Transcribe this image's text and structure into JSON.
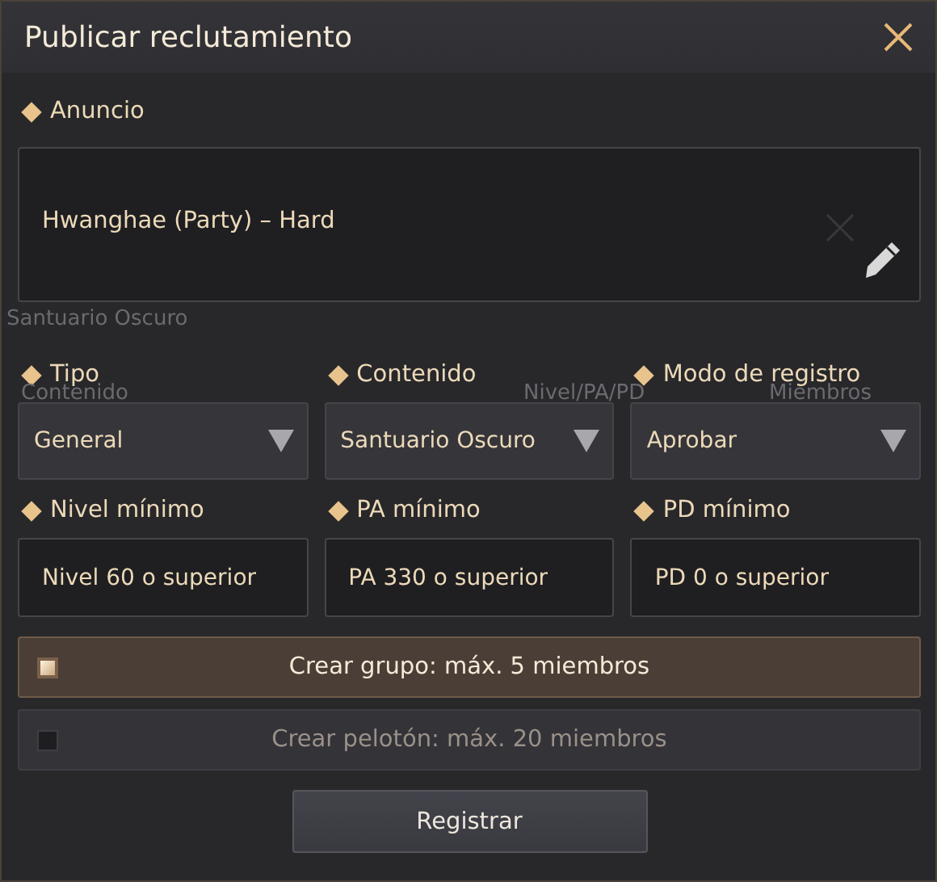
{
  "window": {
    "title": "Publicar reclutamiento"
  },
  "background_texts": [
    {
      "text": "Santuario Oscuro"
    },
    {
      "text": "Contenido"
    },
    {
      "text": "Nivel/PA/PD"
    },
    {
      "text": "Miembros"
    }
  ],
  "announcement": {
    "label": "Anuncio",
    "value": "Hwanghae (Party) – Hard"
  },
  "dropdowns": [
    {
      "label": "Tipo",
      "value": "General"
    },
    {
      "label": "Contenido",
      "value": "Santuario Oscuro"
    },
    {
      "label": "Modo de registro",
      "value": "Aprobar"
    }
  ],
  "minimums": [
    {
      "label": "Nivel mínimo",
      "value": "Nivel 60 o superior"
    },
    {
      "label": "PA mínimo",
      "value": "PA 330 o superior"
    },
    {
      "label": "PD mínimo",
      "value": "PD 0 o superior"
    }
  ],
  "options": [
    {
      "label": "Crear grupo: máx. 5 miembros",
      "selected": true
    },
    {
      "label": "Crear pelotón: máx. 20 miembros",
      "selected": false
    }
  ],
  "buttons": [
    "Registrar"
  ]
}
